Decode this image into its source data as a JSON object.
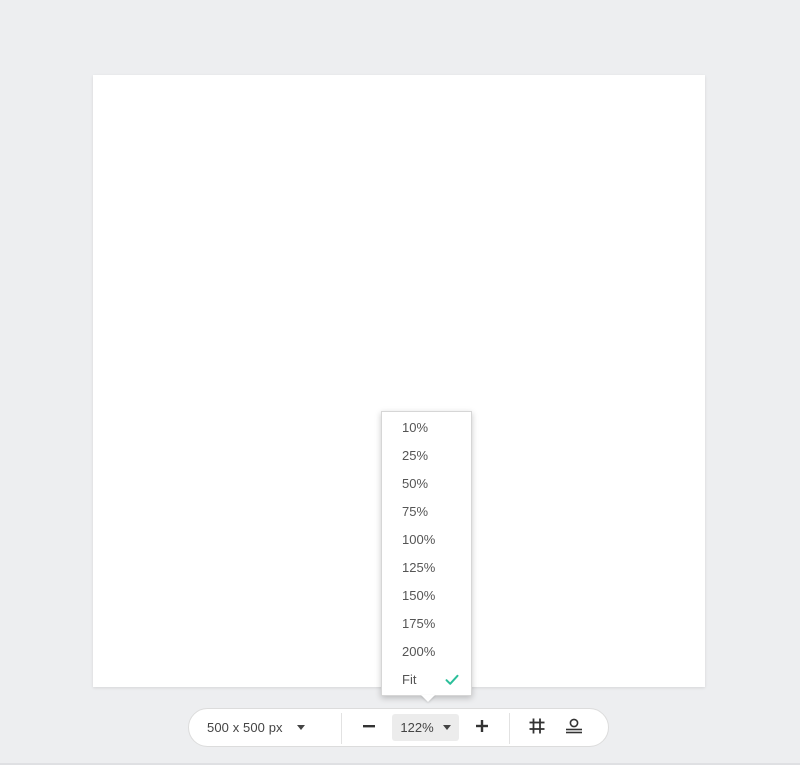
{
  "toolbar": {
    "size_label": "500 x 500 px",
    "zoom_value": "122%",
    "icons": {
      "size_dropdown": "chevron-down-icon",
      "zoom_out": "minus-icon",
      "zoom_in": "plus-icon",
      "zoom_dropdown": "chevron-down-icon",
      "grid": "grid-icon",
      "align": "align-bottom-icon"
    }
  },
  "zoom_menu": {
    "options": [
      {
        "label": "10%",
        "selected": false
      },
      {
        "label": "25%",
        "selected": false
      },
      {
        "label": "50%",
        "selected": false
      },
      {
        "label": "75%",
        "selected": false
      },
      {
        "label": "100%",
        "selected": false
      },
      {
        "label": "125%",
        "selected": false
      },
      {
        "label": "150%",
        "selected": false
      },
      {
        "label": "175%",
        "selected": false
      },
      {
        "label": "200%",
        "selected": false
      },
      {
        "label": "Fit",
        "selected": true
      }
    ],
    "selected_icon": "check-icon"
  },
  "colors": {
    "background": "#edeef0",
    "canvas": "#ffffff",
    "accent_check": "#2bbf9a",
    "icon": "#333333"
  }
}
